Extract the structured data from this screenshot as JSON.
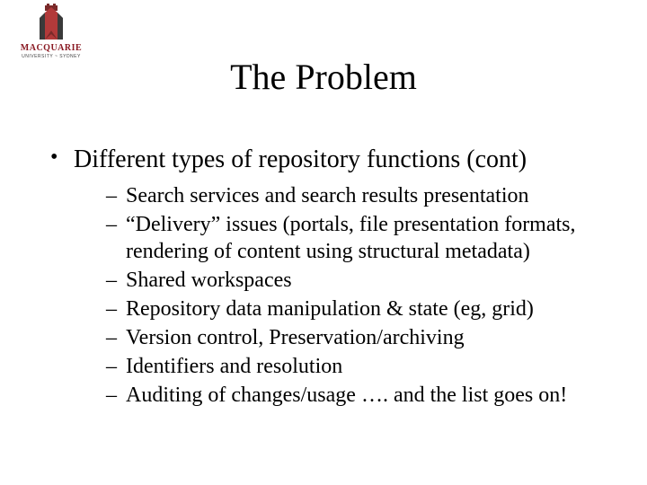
{
  "logo": {
    "name": "MACQUARIE",
    "sub": "UNIVERSITY ~ SYDNEY"
  },
  "title": "The Problem",
  "bullet": {
    "text": "Different types of repository functions (cont)",
    "sub": [
      "Search services and search results presentation",
      "“Delivery” issues (portals, file presentation formats, rendering of content using structural metadata)",
      "Shared workspaces",
      "Repository data manipulation & state (eg, grid)",
      "Version control, Preservation/archiving",
      "Identifiers and resolution",
      "Auditing of changes/usage   …. and the list goes on!"
    ]
  }
}
